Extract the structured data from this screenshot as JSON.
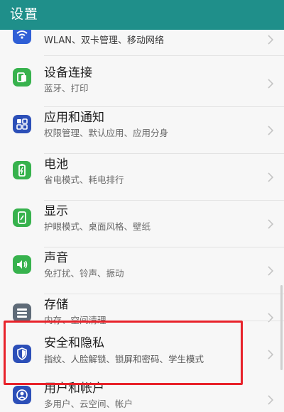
{
  "header": {
    "title": "设置"
  },
  "colors": {
    "header_bg": "#1f8f8a",
    "highlight": "#e8222a"
  },
  "items": [
    {
      "label": "",
      "subtitle": "WLAN、双卡管理、移动网络",
      "icon": "wifi-icon",
      "color": "#2f5fd6"
    },
    {
      "label": "设备连接",
      "subtitle": "蓝牙、打印",
      "icon": "device-connection-icon",
      "color": "#37b24d"
    },
    {
      "label": "应用和通知",
      "subtitle": "权限管理、默认应用、应用分身",
      "icon": "apps-grid-icon",
      "color": "#2c4fb8"
    },
    {
      "label": "电池",
      "subtitle": "省电模式、耗电排行",
      "icon": "battery-icon",
      "color": "#37b24d"
    },
    {
      "label": "显示",
      "subtitle": "护眼模式、桌面风格、壁纸",
      "icon": "display-icon",
      "color": "#37b24d"
    },
    {
      "label": "声音",
      "subtitle": "免打扰、铃声、振动",
      "icon": "sound-icon",
      "color": "#37b24d"
    },
    {
      "label": "存储",
      "subtitle": "内存、空间清理",
      "icon": "storage-icon",
      "color": "#5f6b78"
    },
    {
      "label": "安全和隐私",
      "subtitle": "指纹、人脸解锁、锁屏和密码、学生模式",
      "icon": "shield-icon",
      "color": "#2c4fb8"
    },
    {
      "label": "用户和帐户",
      "subtitle": "多用户、云空间、帐户",
      "icon": "user-icon",
      "color": "#2c4fb8"
    }
  ]
}
